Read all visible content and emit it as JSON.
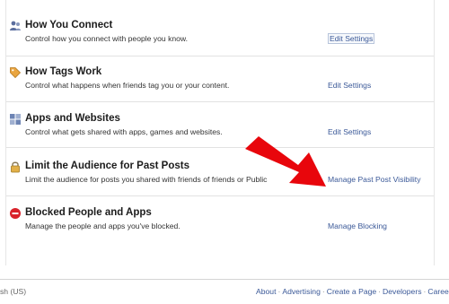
{
  "sections": [
    {
      "icon": "people-icon",
      "title": "How You Connect",
      "description": "Control how you connect with people you know.",
      "link": "Edit Settings"
    },
    {
      "icon": "tag-icon",
      "title": "How Tags Work",
      "description": "Control what happens when friends tag you or your content.",
      "link": "Edit Settings"
    },
    {
      "icon": "apps-icon",
      "title": "Apps and Websites",
      "description": "Control what gets shared with apps, games and websites.",
      "link": "Edit Settings"
    },
    {
      "icon": "lock-icon",
      "title": "Limit the Audience for Past Posts",
      "description": "Limit the audience for posts you shared with friends of friends or Public",
      "link": "Manage Past Post Visibility"
    },
    {
      "icon": "blocked-icon",
      "title": "Blocked People and Apps",
      "description": "Manage the people and apps you've blocked.",
      "link": "Manage Blocking"
    }
  ],
  "footer": {
    "language": "sh (US)",
    "links": [
      "About",
      "Advertising",
      "Create a Page",
      "Developers",
      "Careers"
    ]
  },
  "annotation": {
    "arrow_color": "#e8060c"
  },
  "colors": {
    "link": "#3b5998",
    "divider": "#e2e2e2"
  }
}
